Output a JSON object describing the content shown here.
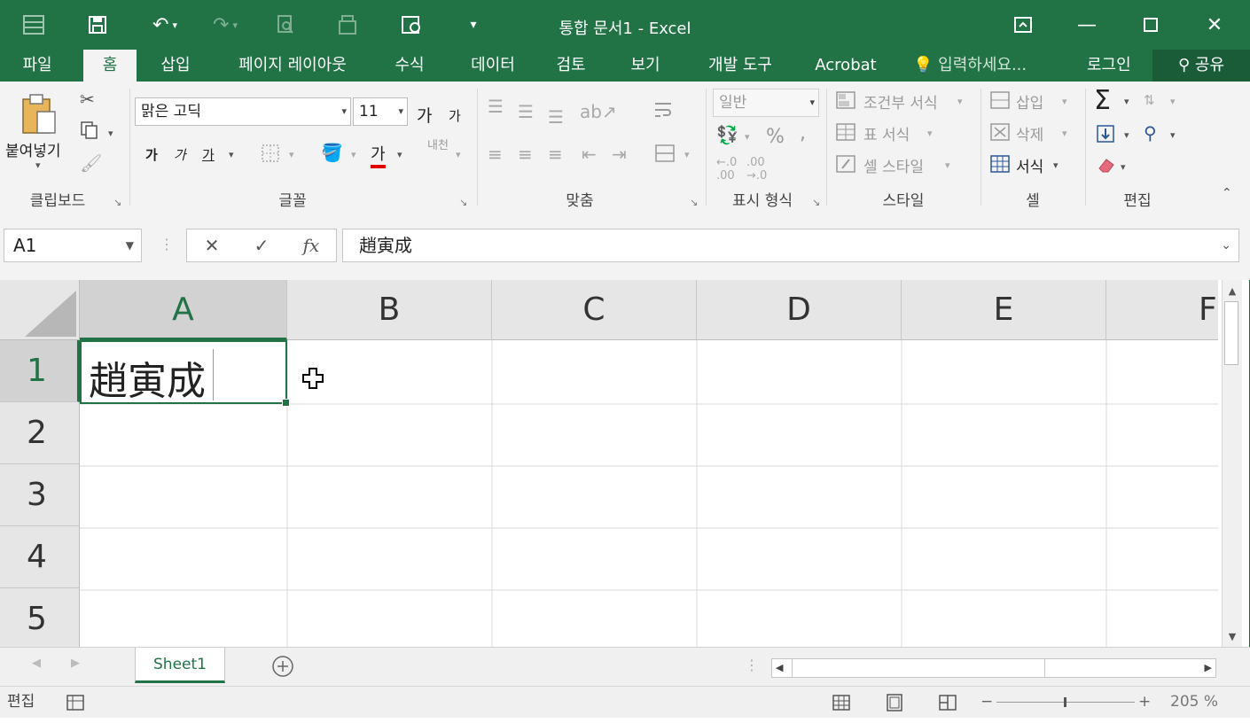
{
  "window": {
    "title": "통합 문서1 - Excel"
  },
  "qat": {
    "save_icon": "save-icon",
    "undo_icon": "undo-icon",
    "redo_icon": "redo-icon"
  },
  "tabs": [
    {
      "label": "파일"
    },
    {
      "label": "홈"
    },
    {
      "label": "삽입"
    },
    {
      "label": "페이지 레이아웃"
    },
    {
      "label": "수식"
    },
    {
      "label": "데이터"
    },
    {
      "label": "검토"
    },
    {
      "label": "보기"
    },
    {
      "label": "개발 도구"
    },
    {
      "label": "Acrobat"
    }
  ],
  "tell_me": "입력하세요...",
  "login": "로그인",
  "share": "공유",
  "ribbon": {
    "clipboard": {
      "paste": "붙여넣기",
      "label": "클립보드"
    },
    "font": {
      "name": "맑은 고딕",
      "size": "11",
      "grow": "가",
      "shrink": "가",
      "bold": "가",
      "italic": "가",
      "underline": "가",
      "font_color": "가",
      "phonetic": "내천",
      "label": "글꼴"
    },
    "alignment": {
      "label": "맞춤"
    },
    "number": {
      "format": "일반",
      "percent": "%",
      "comma": ",",
      "label": "표시 형식"
    },
    "styles": {
      "conditional": "조건부 서식",
      "table": "표 서식",
      "cell_styles": "셀 스타일",
      "label": "스타일"
    },
    "cells": {
      "insert": "삽입",
      "delete": "삭제",
      "format": "서식",
      "label": "셀"
    },
    "editing": {
      "sum": "Σ",
      "label": "편집"
    }
  },
  "formula_bar": {
    "name_box": "A1",
    "cancel": "✕",
    "enter": "✓",
    "fx": "fx",
    "value": "趙寅成"
  },
  "grid": {
    "columns": [
      "A",
      "B",
      "C",
      "D",
      "E",
      "F"
    ],
    "rows": [
      "1",
      "2",
      "3",
      "4",
      "5"
    ],
    "cell_A1": "趙寅成"
  },
  "sheets": [
    {
      "name": "Sheet1"
    }
  ],
  "status": {
    "mode": "편집",
    "zoom": "205 %"
  },
  "colors": {
    "accent": "#217346"
  }
}
